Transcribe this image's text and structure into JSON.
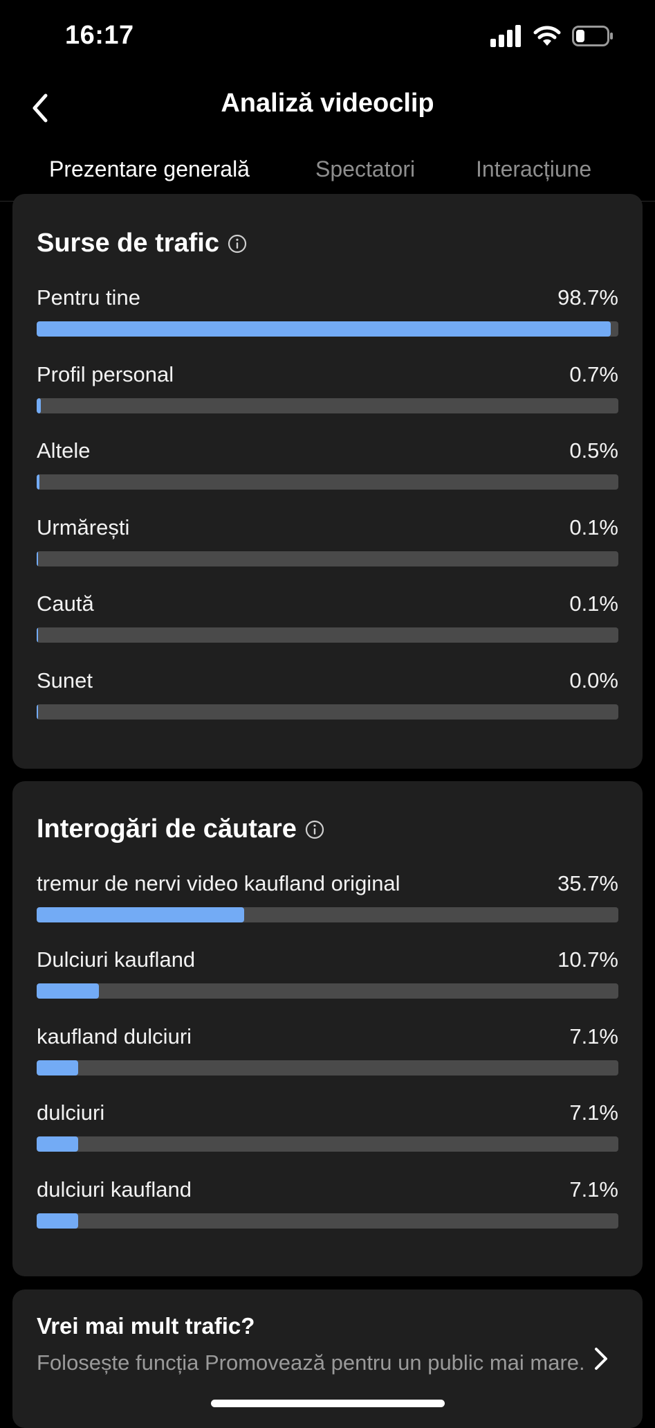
{
  "status_bar": {
    "time": "16:17",
    "icons": [
      "signal-icon",
      "wifi-icon",
      "battery-icon"
    ],
    "battery_level": 0.25
  },
  "header": {
    "title": "Analiză videoclip",
    "back_icon": "chevron-left-icon"
  },
  "tabs": [
    {
      "label": "Prezentare generală",
      "active": true
    },
    {
      "label": "Spectatori",
      "active": false
    },
    {
      "label": "Interacțiune",
      "active": false
    }
  ],
  "traffic_sources": {
    "title": "Surse de trafic",
    "info_icon": "info-icon",
    "items": [
      {
        "label": "Pentru tine",
        "value": "98.7%",
        "percent": 98.7
      },
      {
        "label": "Profil personal",
        "value": "0.7%",
        "percent": 0.7
      },
      {
        "label": "Altele",
        "value": "0.5%",
        "percent": 0.5
      },
      {
        "label": "Urmărești",
        "value": "0.1%",
        "percent": 0.1
      },
      {
        "label": "Caută",
        "value": "0.1%",
        "percent": 0.1
      },
      {
        "label": "Sunet",
        "value": "0.0%",
        "percent": 0.0
      }
    ]
  },
  "search_queries": {
    "title": "Interogări de căutare",
    "info_icon": "info-icon",
    "items": [
      {
        "label": "tremur de nervi video kaufland original",
        "value": "35.7%",
        "percent": 35.7
      },
      {
        "label": "Dulciuri kaufland",
        "value": "10.7%",
        "percent": 10.7
      },
      {
        "label": "kaufland dulciuri",
        "value": "7.1%",
        "percent": 7.1
      },
      {
        "label": "dulciuri",
        "value": "7.1%",
        "percent": 7.1
      },
      {
        "label": "dulciuri kaufland",
        "value": "7.1%",
        "percent": 7.1
      }
    ]
  },
  "promo": {
    "title": "Vrei mai mult trafic?",
    "text": "Folosește funcția Promovează pentru un public mai mare.",
    "chevron_icon": "chevron-right-icon"
  },
  "colors": {
    "background": "#000000",
    "card": "#1f1f1f",
    "bar_track": "#4a4a4a",
    "bar_fill": "#73abf5",
    "inactive_tab": "#8e8e8e",
    "secondary_text": "#9a9a9a"
  }
}
